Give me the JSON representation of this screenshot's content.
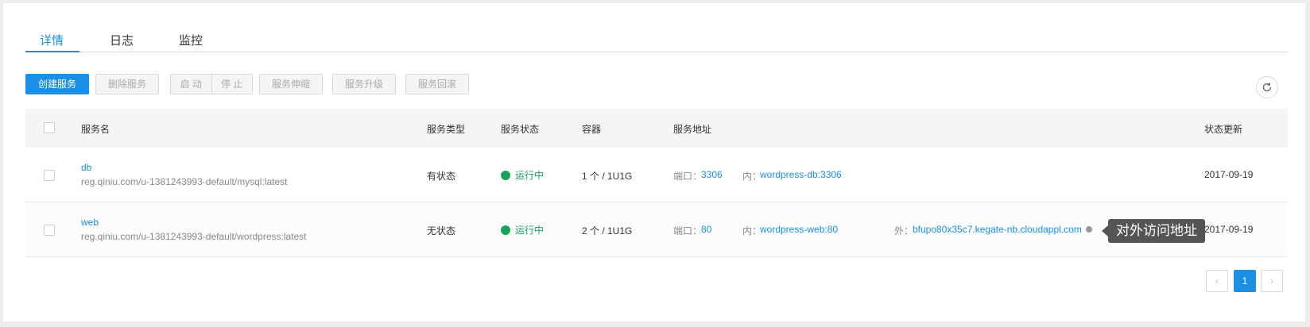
{
  "tabs": [
    {
      "label": "详情",
      "active": true
    },
    {
      "label": "日志",
      "active": false
    },
    {
      "label": "监控",
      "active": false
    }
  ],
  "toolbar": {
    "create": "创建服务",
    "delete": "删除服务",
    "start": "启 动",
    "stop": "停 止",
    "scale": "服务伸缩",
    "upgrade": "服务升级",
    "rollback": "服务回滚",
    "refresh_icon": "refresh-icon"
  },
  "table": {
    "headers": {
      "name": "服务名",
      "type": "服务类型",
      "status": "服务状态",
      "container": "容器",
      "address": "服务地址",
      "updated": "状态更新"
    },
    "rows": [
      {
        "name": "db",
        "image": "reg.qiniu.com/u-1381243993-default/mysql:latest",
        "type": "有状态",
        "status": "运行中",
        "container": "1 个 / 1U1G",
        "port_label": "端口：",
        "port": "3306",
        "internal_label": "内：",
        "internal": "wordpress-db:3306",
        "external_label": "",
        "external": "",
        "updated": "2017-09-19"
      },
      {
        "name": "web",
        "image": "reg.qiniu.com/u-1381243993-default/wordpress:latest",
        "type": "无状态",
        "status": "运行中",
        "container": "2 个 / 1U1G",
        "port_label": "端口：",
        "port": "80",
        "internal_label": "内：",
        "internal": "wordpress-web:80",
        "external_label": "外：",
        "external": "bfupo80x35c7.kegate-nb.cloudappl.com",
        "updated": "2017-09-19"
      }
    ]
  },
  "tooltip": "对外访问地址",
  "pagination": {
    "prev": "‹",
    "current": "1",
    "next": "›"
  },
  "colors": {
    "accent": "#1a8fe3",
    "running": "#19a35a"
  }
}
